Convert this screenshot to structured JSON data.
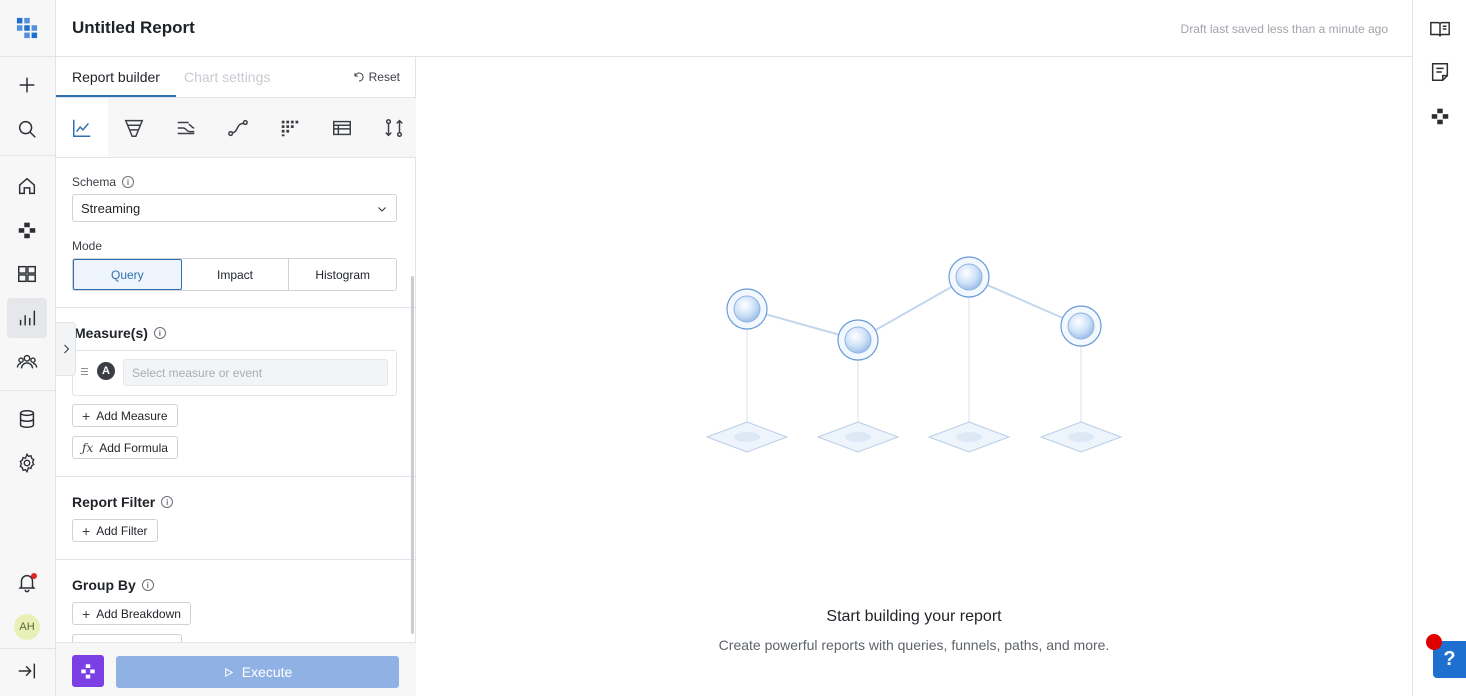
{
  "header": {
    "title": "Untitled Report",
    "saved_status": "Draft last saved less than a minute ago"
  },
  "left_rail": {
    "items": [
      {
        "icon": "app-logo-icon"
      },
      {
        "icon": "plus-icon"
      },
      {
        "icon": "search-icon"
      },
      {
        "icon": "home-icon"
      },
      {
        "icon": "cluster-icon"
      },
      {
        "icon": "dashboard-icon"
      },
      {
        "icon": "bar-chart-icon",
        "active": true
      },
      {
        "icon": "users-icon"
      },
      {
        "icon": "database-icon"
      },
      {
        "icon": "gear-icon"
      },
      {
        "icon": "bell-icon"
      },
      {
        "icon": "collapse-rail-icon"
      }
    ],
    "avatar_initials": "AH"
  },
  "right_rail": {
    "items": [
      {
        "icon": "book-icon"
      },
      {
        "icon": "notes-icon"
      },
      {
        "icon": "cluster-icon"
      }
    ]
  },
  "builder": {
    "tabs": [
      {
        "label": "Report builder",
        "active": true
      },
      {
        "label": "Chart settings",
        "active": false
      }
    ],
    "reset_label": "Reset",
    "chart_types": [
      {
        "icon": "line-chart-icon",
        "active": true
      },
      {
        "icon": "funnel-icon"
      },
      {
        "icon": "flow-icon"
      },
      {
        "icon": "path-icon"
      },
      {
        "icon": "grid-dots-icon"
      },
      {
        "icon": "table-icon"
      },
      {
        "icon": "compare-icon"
      }
    ],
    "schema": {
      "label": "Schema",
      "value": "Streaming"
    },
    "mode": {
      "label": "Mode",
      "options": [
        "Query",
        "Impact",
        "Histogram"
      ],
      "selected": "Query"
    },
    "measures": {
      "title": "Measure(s)",
      "badge": "A",
      "input_placeholder": "Select measure or event",
      "add_measure": "Add Measure",
      "add_formula": "Add Formula"
    },
    "report_filter": {
      "title": "Report Filter",
      "add_filter": "Add Filter"
    },
    "group_by": {
      "title": "Group By",
      "add_breakdown": "Add Breakdown"
    },
    "execute_label": "Execute"
  },
  "main": {
    "empty_title": "Start building your report",
    "empty_subtitle": "Create powerful reports with queries, funnels, paths, and more."
  },
  "colors": {
    "accent": "#2f6fb3",
    "execute_disabled": "#8fb1e3",
    "brand_purple": "#7b3fe4",
    "help_blue": "#1f6fd0"
  }
}
